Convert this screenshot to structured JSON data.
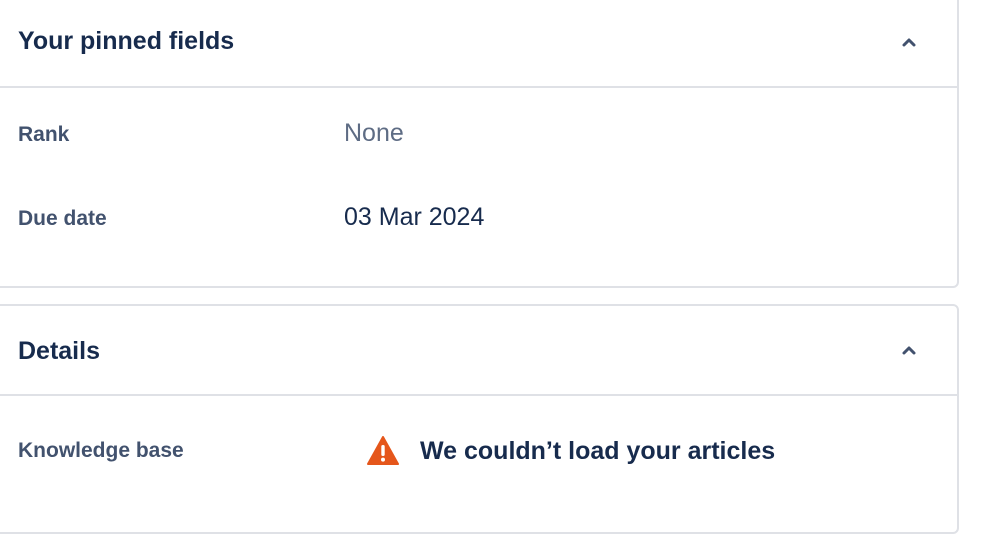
{
  "pinned_panel": {
    "title": "Your pinned fields",
    "fields": [
      {
        "label": "Rank",
        "value": "None"
      },
      {
        "label": "Due date",
        "value": "03 Mar 2024"
      }
    ]
  },
  "details_panel": {
    "title": "Details",
    "fields": [
      {
        "label": "Knowledge base",
        "error_message": "We couldn’t load your articles"
      }
    ]
  },
  "colors": {
    "text_primary": "#172b4d",
    "text_label": "#42526e",
    "text_muted": "#5e6c84",
    "border": "#dfe1e6",
    "warning": "#e5561b"
  },
  "icons": {
    "collapse": "chevron-up-icon",
    "warning": "warning-icon"
  }
}
